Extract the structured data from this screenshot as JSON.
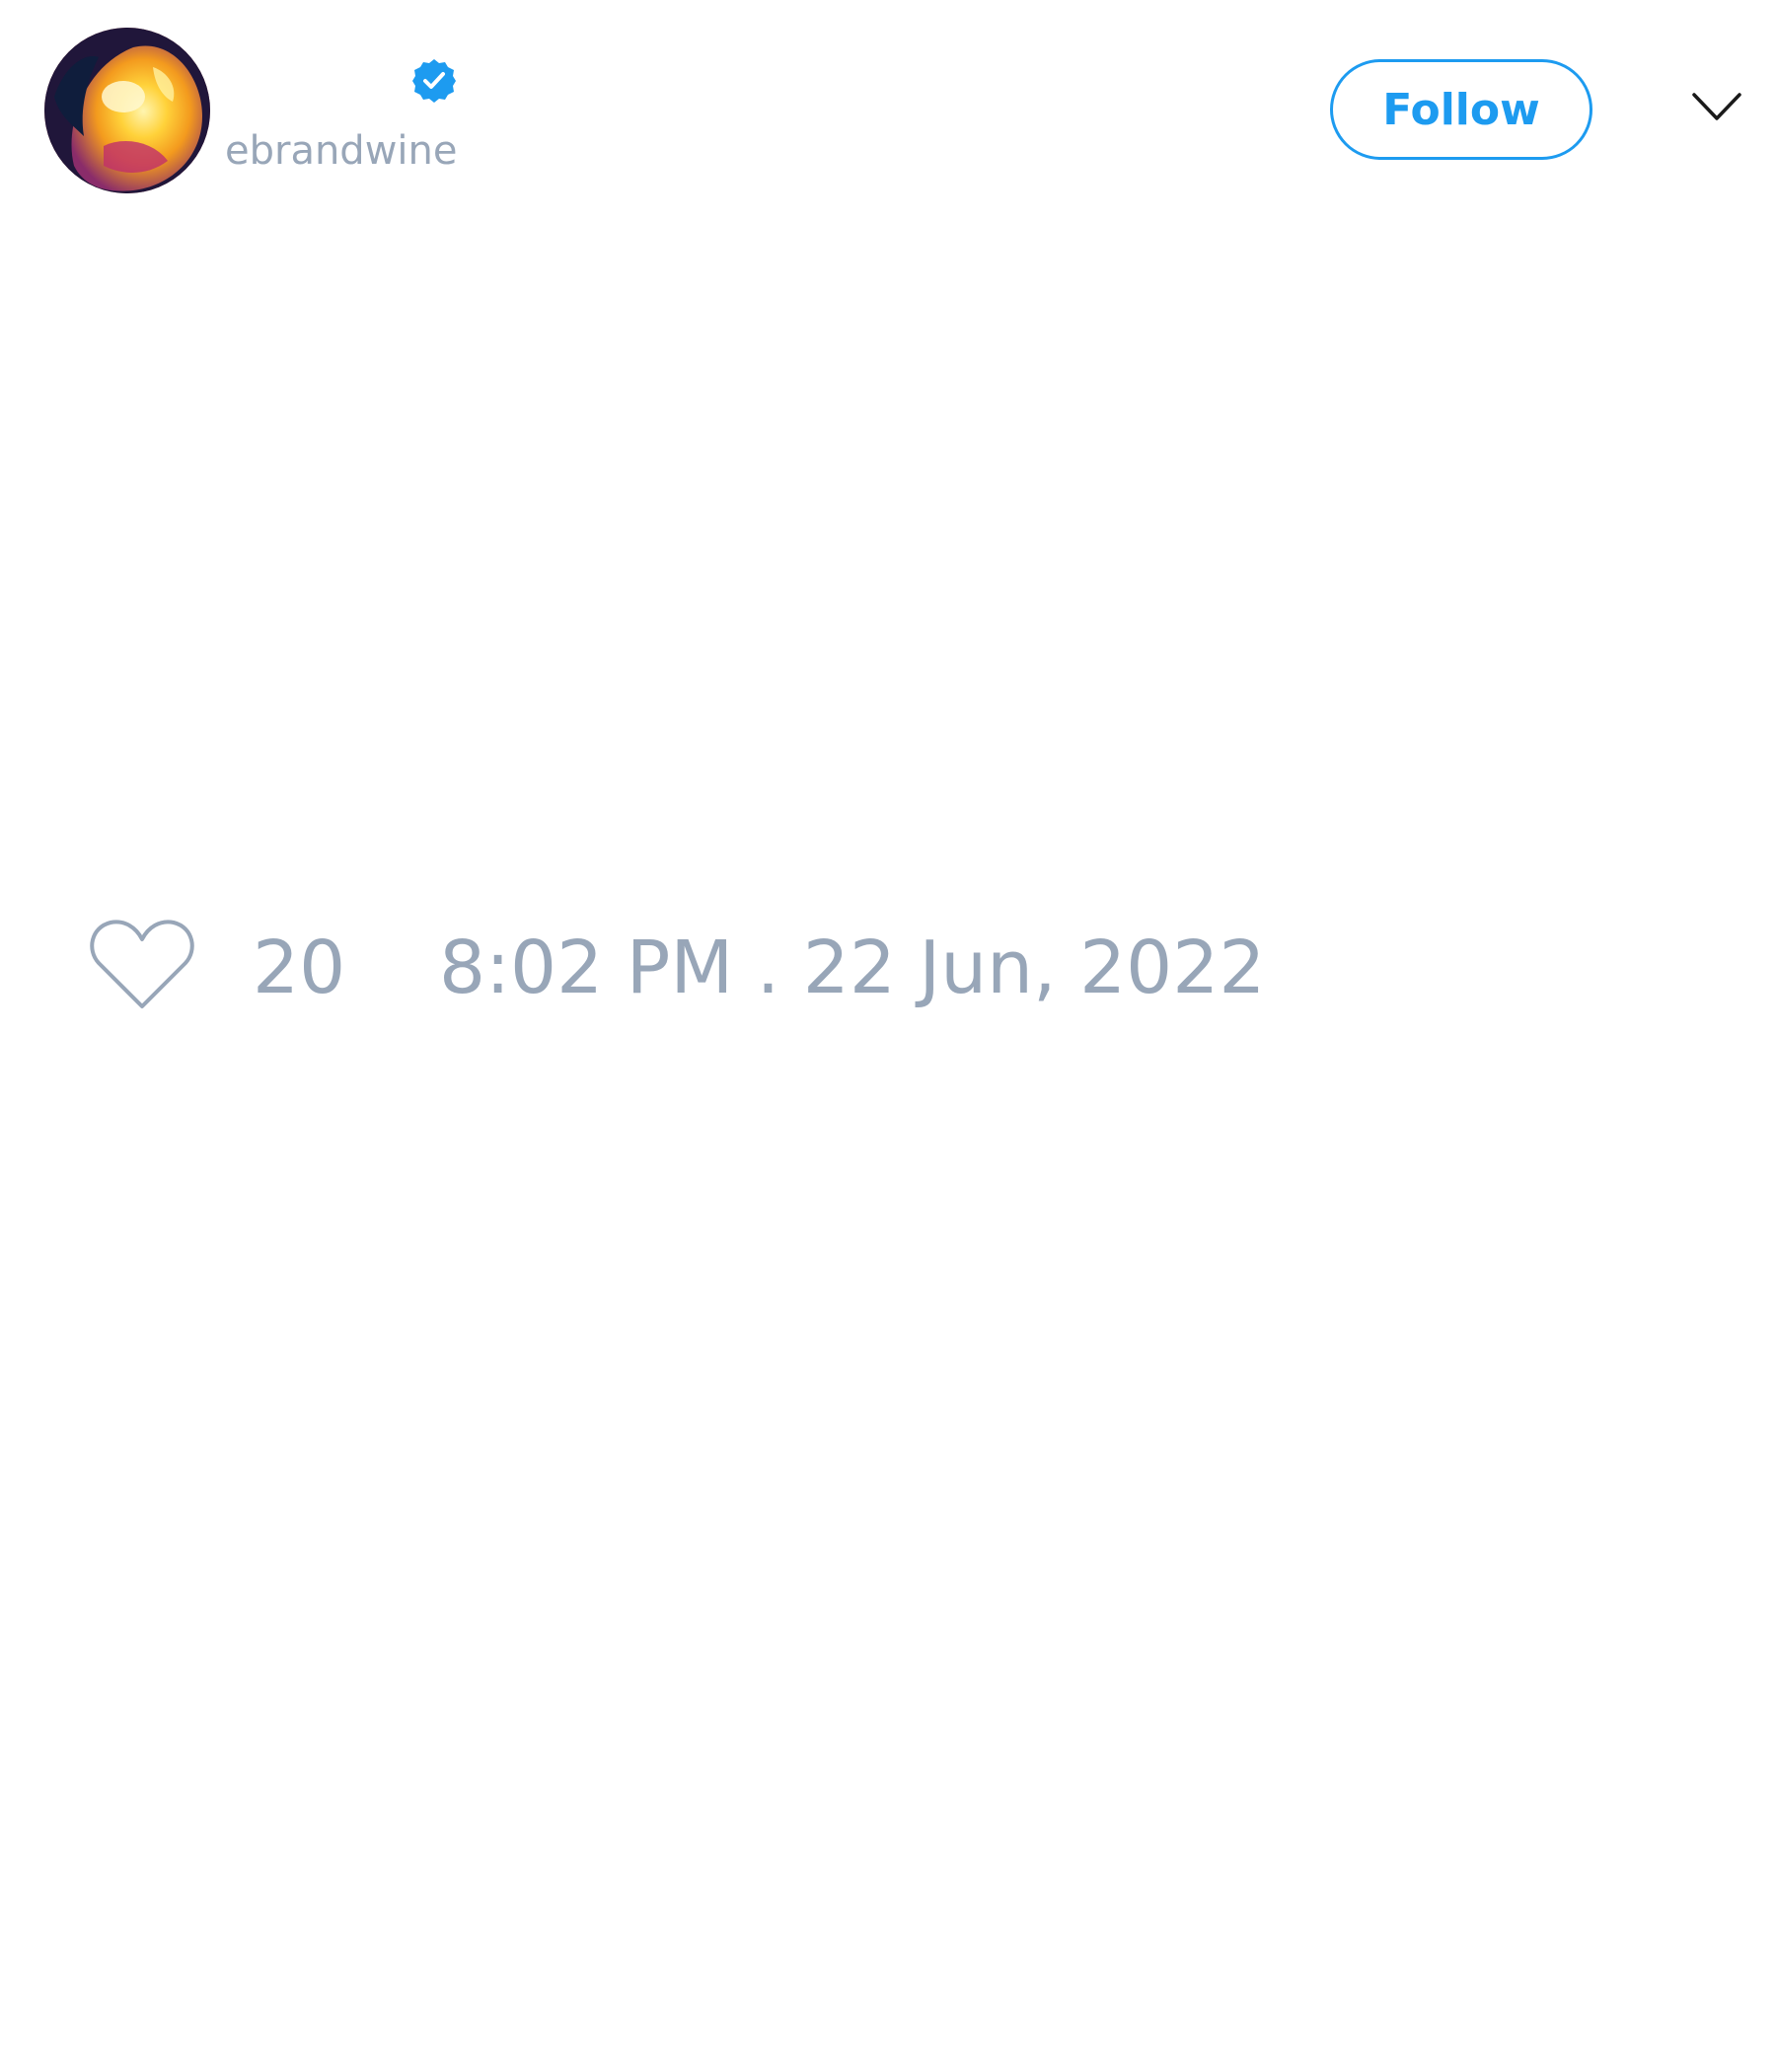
{
  "tweet": {
    "author": {
      "handle": "ebrandwine",
      "verified": true,
      "avatar_icon": "avatar-image"
    },
    "follow_label": "Follow",
    "menu_icon": "chevron-down-icon",
    "likes": {
      "icon": "heart-icon",
      "count": "20"
    },
    "timestamp": "8:02 PM . 22 Jun, 2022"
  },
  "colors": {
    "accent": "#1d9bf0",
    "muted_text": "#98a6b8",
    "background": "#ffffff"
  }
}
